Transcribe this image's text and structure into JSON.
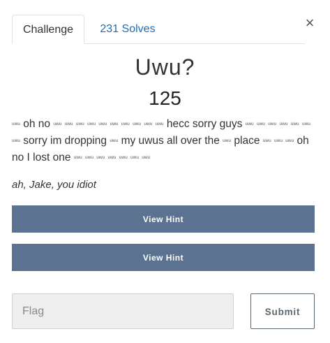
{
  "tabs": {
    "challenge": "Challenge",
    "solves": "231 Solves"
  },
  "close_icon": "×",
  "challenge": {
    "name": "Uwu?",
    "value": "125",
    "description": {
      "uwu": "uwu",
      "t1": "oh no",
      "t2": "hecc sorry guys",
      "t3": "sorry im dropping",
      "t4": "my uwus all over the",
      "t5": "place",
      "t6": "oh no I lost one"
    },
    "aside": "ah, Jake, you idiot"
  },
  "hints": [
    {
      "label": "View Hint"
    },
    {
      "label": "View Hint"
    }
  ],
  "flag": {
    "placeholder": "Flag",
    "value": ""
  },
  "submit_label": "Submit"
}
